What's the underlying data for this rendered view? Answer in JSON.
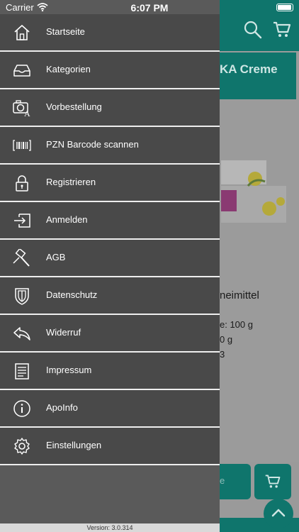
{
  "status_bar": {
    "carrier": "Carrier",
    "time": "6:07 PM"
  },
  "background": {
    "card_title": "KA Creme",
    "card_subtitle": "neimittel",
    "details": [
      "e: 100 g",
      "0 g",
      "3"
    ],
    "button_a_text": "e"
  },
  "menu": {
    "items": [
      {
        "label": "Startseite",
        "icon": "home-icon"
      },
      {
        "label": "Kategorien",
        "icon": "inbox-icon"
      },
      {
        "label": "Vorbestellung",
        "icon": "camera-prescription-icon"
      },
      {
        "label": "PZN Barcode scannen",
        "icon": "barcode-icon"
      },
      {
        "label": "Registrieren",
        "icon": "lock-icon"
      },
      {
        "label": "Anmelden",
        "icon": "login-icon"
      },
      {
        "label": "AGB",
        "icon": "gavel-icon"
      },
      {
        "label": "Datenschutz",
        "icon": "shield-icon"
      },
      {
        "label": "Widerruf",
        "icon": "reply-icon"
      },
      {
        "label": "Impressum",
        "icon": "document-icon"
      },
      {
        "label": "ApoInfo",
        "icon": "info-icon"
      },
      {
        "label": "Einstellungen",
        "icon": "gear-icon"
      }
    ]
  },
  "footer": {
    "version": "Version: 3.0.314"
  }
}
